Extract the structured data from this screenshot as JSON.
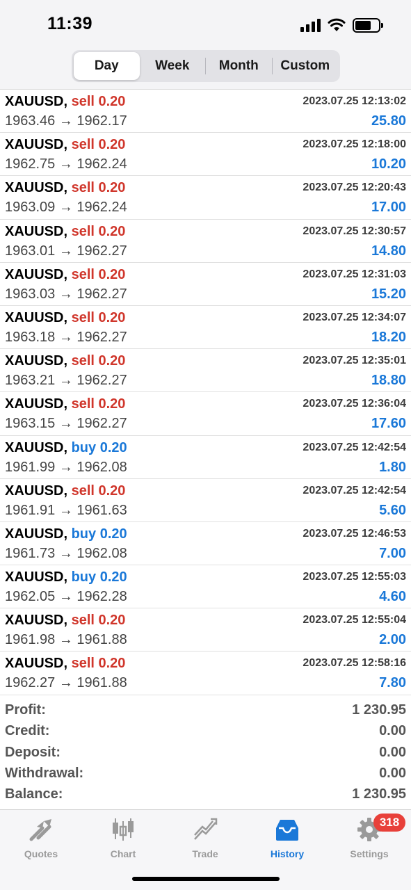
{
  "status_bar": {
    "time": "11:39"
  },
  "period_tabs": [
    {
      "label": "Day",
      "active": true
    },
    {
      "label": "Week",
      "active": false
    },
    {
      "label": "Month",
      "active": false
    },
    {
      "label": "Custom",
      "active": false
    }
  ],
  "trades": [
    {
      "symbol": "XAUUSD,",
      "side": "sell 0.20",
      "type": "sell",
      "time": "2023.07.25 12:13:02",
      "prices": "1963.46 → 1962.17",
      "profit": "25.80"
    },
    {
      "symbol": "XAUUSD,",
      "side": "sell 0.20",
      "type": "sell",
      "time": "2023.07.25 12:18:00",
      "prices": "1962.75 → 1962.24",
      "profit": "10.20"
    },
    {
      "symbol": "XAUUSD,",
      "side": "sell 0.20",
      "type": "sell",
      "time": "2023.07.25 12:20:43",
      "prices": "1963.09 → 1962.24",
      "profit": "17.00"
    },
    {
      "symbol": "XAUUSD,",
      "side": "sell 0.20",
      "type": "sell",
      "time": "2023.07.25 12:30:57",
      "prices": "1963.01 → 1962.27",
      "profit": "14.80"
    },
    {
      "symbol": "XAUUSD,",
      "side": "sell 0.20",
      "type": "sell",
      "time": "2023.07.25 12:31:03",
      "prices": "1963.03 → 1962.27",
      "profit": "15.20"
    },
    {
      "symbol": "XAUUSD,",
      "side": "sell 0.20",
      "type": "sell",
      "time": "2023.07.25 12:34:07",
      "prices": "1963.18 → 1962.27",
      "profit": "18.20"
    },
    {
      "symbol": "XAUUSD,",
      "side": "sell 0.20",
      "type": "sell",
      "time": "2023.07.25 12:35:01",
      "prices": "1963.21 → 1962.27",
      "profit": "18.80"
    },
    {
      "symbol": "XAUUSD,",
      "side": "sell 0.20",
      "type": "sell",
      "time": "2023.07.25 12:36:04",
      "prices": "1963.15 → 1962.27",
      "profit": "17.60"
    },
    {
      "symbol": "XAUUSD,",
      "side": "buy 0.20",
      "type": "buy",
      "time": "2023.07.25 12:42:54",
      "prices": "1961.99 → 1962.08",
      "profit": "1.80"
    },
    {
      "symbol": "XAUUSD,",
      "side": "sell 0.20",
      "type": "sell",
      "time": "2023.07.25 12:42:54",
      "prices": "1961.91 → 1961.63",
      "profit": "5.60"
    },
    {
      "symbol": "XAUUSD,",
      "side": "buy 0.20",
      "type": "buy",
      "time": "2023.07.25 12:46:53",
      "prices": "1961.73 → 1962.08",
      "profit": "7.00"
    },
    {
      "symbol": "XAUUSD,",
      "side": "buy 0.20",
      "type": "buy",
      "time": "2023.07.25 12:55:03",
      "prices": "1962.05 → 1962.28",
      "profit": "4.60"
    },
    {
      "symbol": "XAUUSD,",
      "side": "sell 0.20",
      "type": "sell",
      "time": "2023.07.25 12:55:04",
      "prices": "1961.98 → 1961.88",
      "profit": "2.00"
    },
    {
      "symbol": "XAUUSD,",
      "side": "sell 0.20",
      "type": "sell",
      "time": "2023.07.25 12:58:16",
      "prices": "1962.27 → 1961.88",
      "profit": "7.80"
    }
  ],
  "summary": [
    {
      "label": "Profit:",
      "value": "1 230.95"
    },
    {
      "label": "Credit:",
      "value": "0.00"
    },
    {
      "label": "Deposit:",
      "value": "0.00"
    },
    {
      "label": "Withdrawal:",
      "value": "0.00"
    },
    {
      "label": "Balance:",
      "value": "1 230.95"
    }
  ],
  "tab_bar": {
    "items": [
      {
        "label": "Quotes",
        "icon": "quotes-arrows-icon",
        "active": false
      },
      {
        "label": "Chart",
        "icon": "candlestick-chart-icon",
        "active": false
      },
      {
        "label": "Trade",
        "icon": "trade-trend-icon",
        "active": false
      },
      {
        "label": "History",
        "icon": "history-inbox-icon",
        "active": true
      },
      {
        "label": "Settings",
        "icon": "gear-icon",
        "active": false
      }
    ],
    "settings_badge": "318"
  },
  "colors": {
    "sell": "#d0362b",
    "buy": "#1a78d8",
    "profit": "#1a78d8",
    "active_tab": "#1a78d8",
    "inactive_tab": "#9a9a9a",
    "badge": "#e8403a"
  }
}
